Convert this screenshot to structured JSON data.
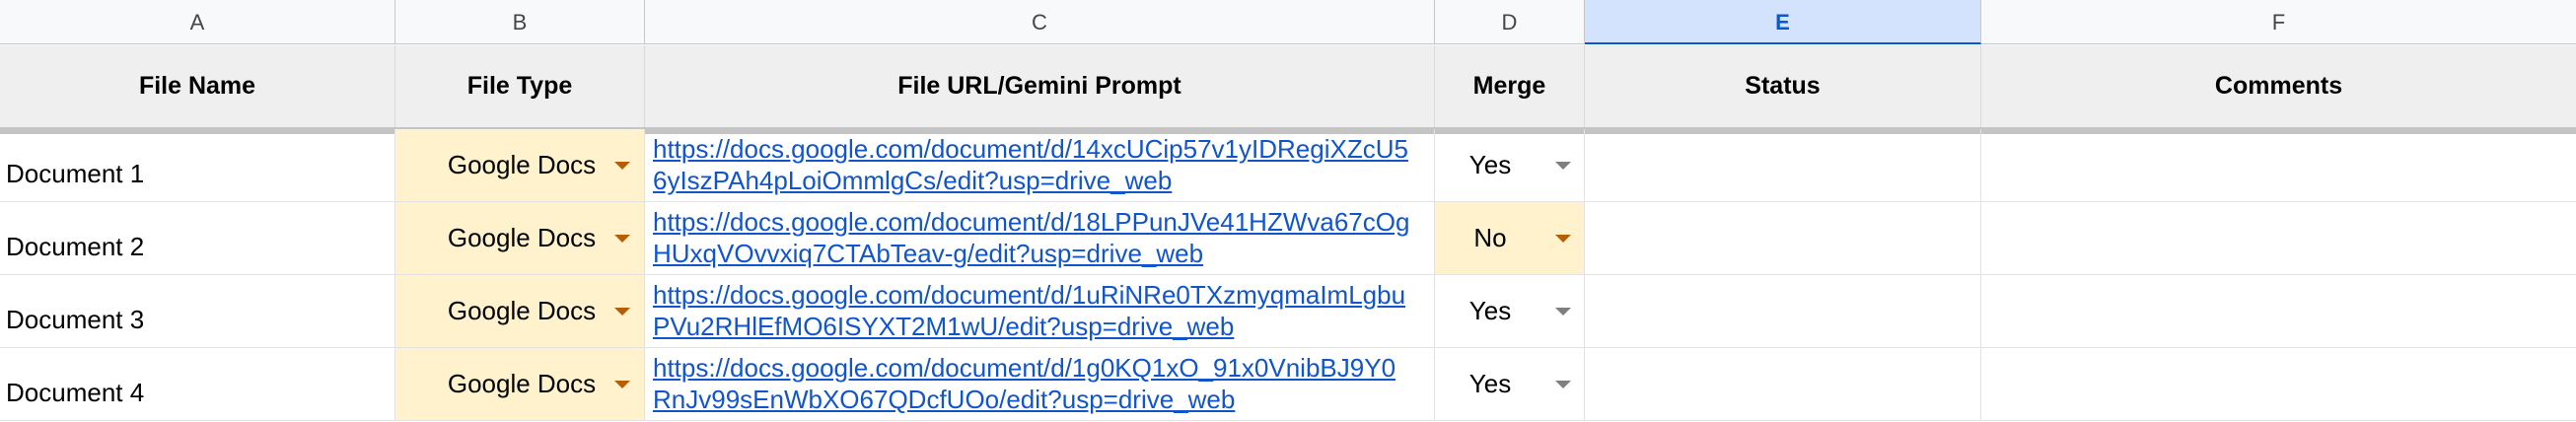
{
  "columns": [
    "A",
    "B",
    "C",
    "D",
    "E",
    "F"
  ],
  "selected_column": "E",
  "headers": {
    "file_name": "File Name",
    "file_type": "File Type",
    "file_url": "File URL/Gemini Prompt",
    "merge": "Merge",
    "status": "Status",
    "comments": "Comments"
  },
  "rows": [
    {
      "name": "Document 1",
      "type": "Google Docs",
      "url_line1": "https://docs.google.com/document/d/14xcUCip57v1yIDRegiXZcU5",
      "url_line2": "6yIszPAh4pLoiOmmlgCs/edit?usp=drive_web",
      "merge": "Yes",
      "status": "",
      "comments": ""
    },
    {
      "name": "Document 2",
      "type": "Google Docs",
      "url_line1": "https://docs.google.com/document/d/18LPPunJVe41HZWva67cOg",
      "url_line2": "HUxqVOvvxiq7CTAbTeav-g/edit?usp=drive_web",
      "merge": "No",
      "status": "",
      "comments": ""
    },
    {
      "name": "Document 3",
      "type": "Google Docs",
      "url_line1": "https://docs.google.com/document/d/1uRiNRe0TXzmyqmaImLgbu",
      "url_line2": "PVu2RHlEfMO6ISYXT2M1wU/edit?usp=drive_web",
      "merge": "Yes",
      "status": "",
      "comments": ""
    },
    {
      "name": "Document 4",
      "type": "Google Docs",
      "url_line1": "https://docs.google.com/document/d/1g0KQ1xO_91x0VnibBJ9Y0",
      "url_line2": "RnJv99sEnWbXO67QDcfUOo/edit?usp=drive_web",
      "merge": "Yes",
      "status": "",
      "comments": ""
    }
  ],
  "colors": {
    "dropdown_chip": "#fff2cc",
    "link": "#1155cc",
    "selected_column": "#d3e3fd",
    "header_row": "#efefef"
  }
}
